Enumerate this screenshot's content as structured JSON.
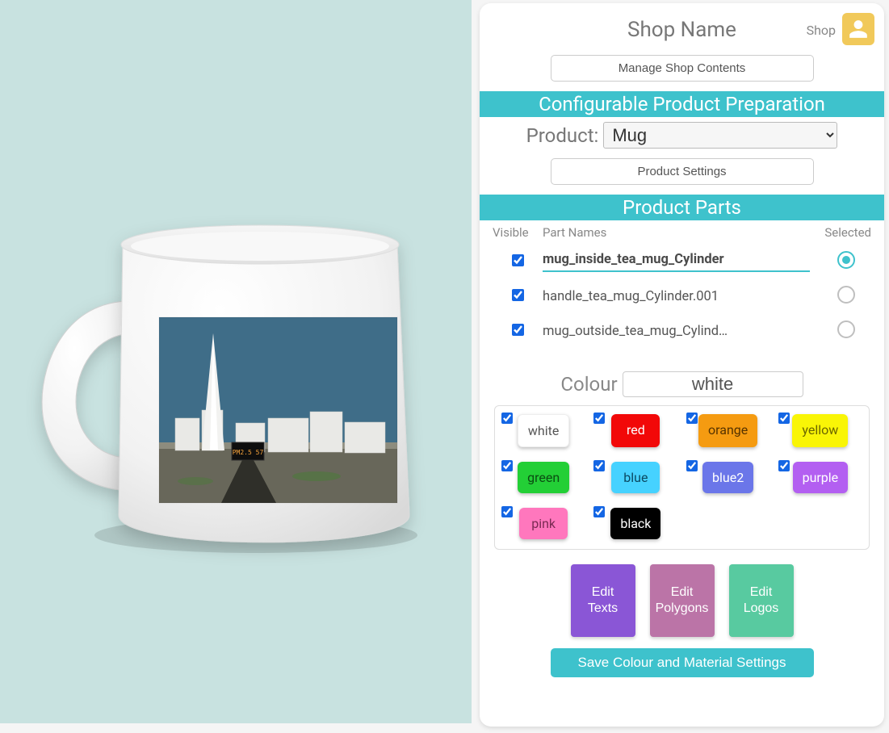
{
  "header": {
    "title": "Shop Name",
    "shop_link": "Shop"
  },
  "buttons": {
    "manage_shop": "Manage Shop Contents",
    "product_settings": "Product Settings",
    "edit_texts": "Edit Texts",
    "edit_polygons": "Edit Polygons",
    "edit_logos": "Edit Logos",
    "save": "Save Colour and Material Settings"
  },
  "sections": {
    "config_prep": "Configurable Product Preparation",
    "product_parts": "Product Parts"
  },
  "product": {
    "label": "Product:",
    "selected": "Mug"
  },
  "parts_header": {
    "visible": "Visible",
    "names": "Part Names",
    "selected": "Selected"
  },
  "parts": [
    {
      "name": "mug_inside_tea_mug_Cylinder",
      "visible": true,
      "selected": true
    },
    {
      "name": "handle_tea_mug_Cylinder.001",
      "visible": true,
      "selected": false
    },
    {
      "name": "mug_outside_tea_mug_Cylind…",
      "visible": true,
      "selected": false
    }
  ],
  "colour": {
    "label": "Colour",
    "value": "white"
  },
  "swatches": [
    {
      "name": "white",
      "cls": "sw-white",
      "checked": true
    },
    {
      "name": "red",
      "cls": "sw-red",
      "checked": true
    },
    {
      "name": "orange",
      "cls": "sw-orange",
      "checked": true
    },
    {
      "name": "yellow",
      "cls": "sw-yellow",
      "checked": true
    },
    {
      "name": "green",
      "cls": "sw-green",
      "checked": true
    },
    {
      "name": "blue",
      "cls": "sw-blue",
      "checked": true
    },
    {
      "name": "blue2",
      "cls": "sw-blue2",
      "checked": true
    },
    {
      "name": "purple",
      "cls": "sw-purple",
      "checked": true
    },
    {
      "name": "pink",
      "cls": "sw-pink",
      "checked": true
    },
    {
      "name": "black",
      "cls": "sw-black",
      "checked": true
    }
  ],
  "preview": {
    "decal_label": "PM2.5  57"
  }
}
